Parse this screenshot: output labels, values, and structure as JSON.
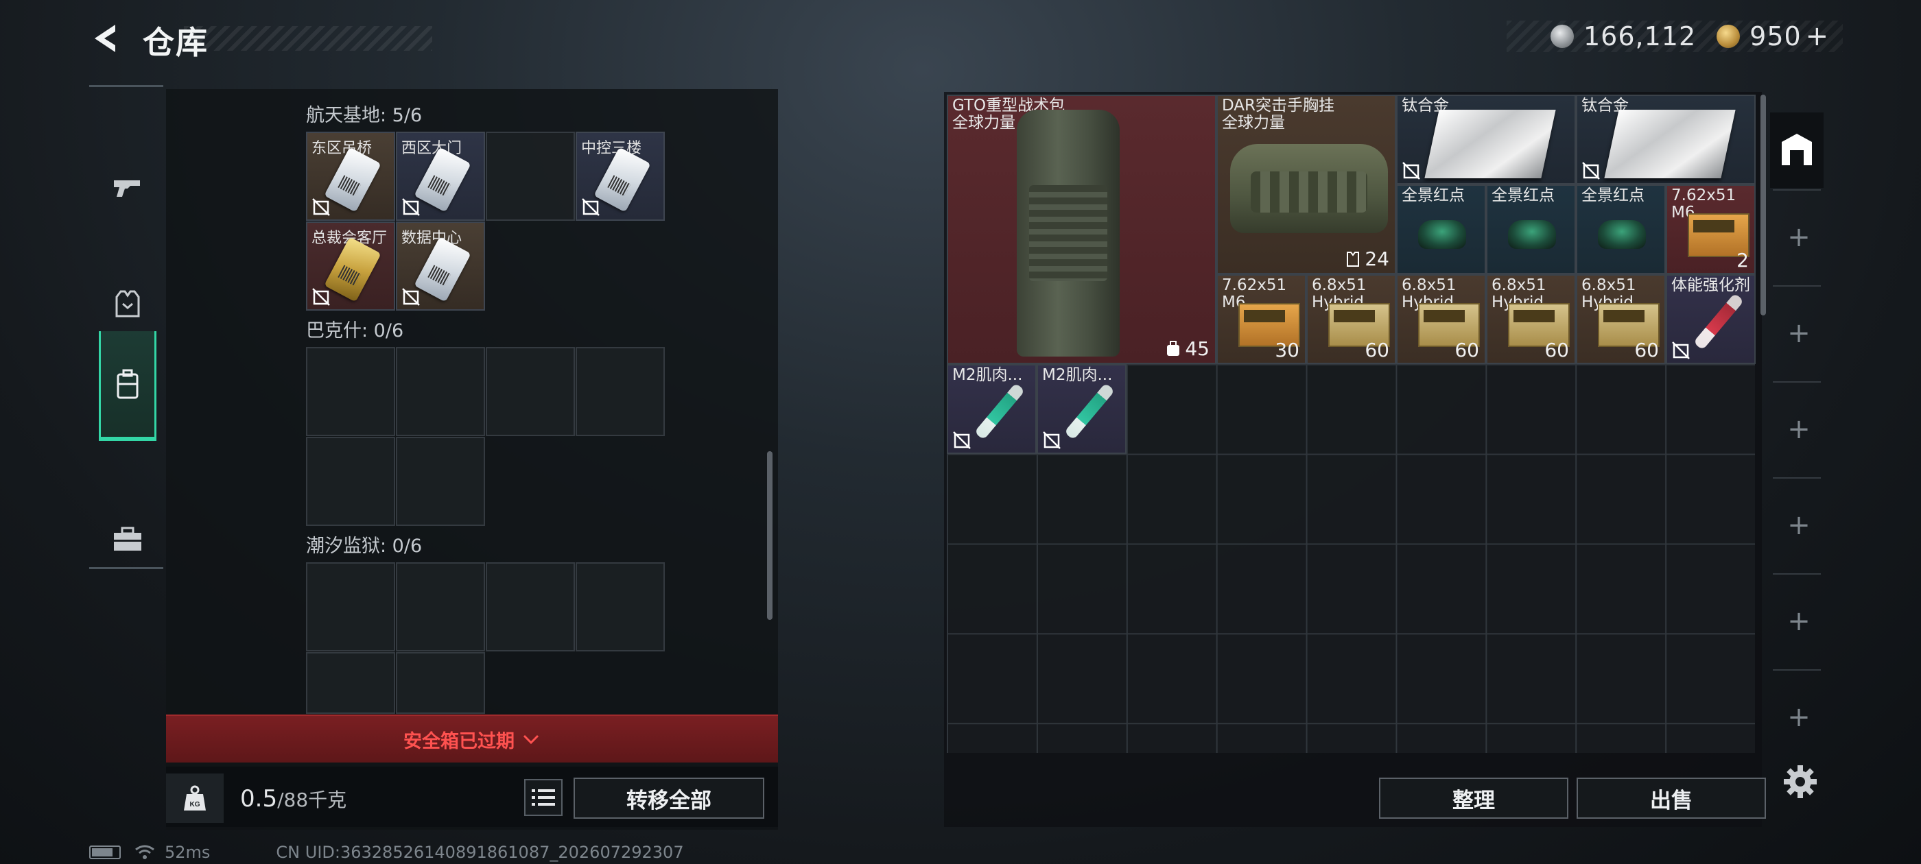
{
  "header": {
    "title": "仓库",
    "currency": {
      "silver": "166,112",
      "gold": "950",
      "gold_plus": "+"
    }
  },
  "nav": {
    "items": [
      "weapon",
      "armor",
      "backpack",
      "toolbox"
    ],
    "active": "backpack"
  },
  "safebox": {
    "sections": [
      {
        "title": "航天基地: 5/6",
        "keys": [
          {
            "label": "东区吊桥",
            "color": "tan"
          },
          {
            "label": "西区大门",
            "color": "blue"
          },
          {
            "label": "",
            "color": "empty"
          },
          {
            "label": "中控三楼",
            "color": "blue"
          },
          {
            "label": "总裁会客厅",
            "color": "red"
          },
          {
            "label": "数据中心",
            "color": "tan"
          }
        ]
      },
      {
        "title": "巴克什: 0/6"
      },
      {
        "title": "潮汐监狱: 0/6"
      }
    ],
    "expired_text": "安全箱已过期",
    "weight_value": "0.5",
    "weight_max": "/88千克",
    "transfer_all_label": "转移全部"
  },
  "stash": {
    "items": [
      {
        "name": "GTO重型战术包",
        "sub": "全球力量",
        "badge": "45"
      },
      {
        "name": "DAR突击手胸挂",
        "sub": "全球力量",
        "badge": "24"
      },
      {
        "name": "钛合金"
      },
      {
        "name": "钛合金"
      },
      {
        "name": "全景红点"
      },
      {
        "name": "全景红点"
      },
      {
        "name": "全景红点"
      },
      {
        "name": "7.62x51",
        "sub": "M6...",
        "count": "2"
      },
      {
        "name": "7.62x51",
        "sub": "M6...",
        "count": "30"
      },
      {
        "name": "6.8x51",
        "sub": "Hybrid",
        "count": "60"
      },
      {
        "name": "6.8x51",
        "sub": "Hybrid",
        "count": "60"
      },
      {
        "name": "6.8x51",
        "sub": "Hybrid",
        "count": "60"
      },
      {
        "name": "6.8x51",
        "sub": "Hybrid",
        "count": "60"
      },
      {
        "name": "体能强化剂"
      },
      {
        "name": "M2肌肉..."
      },
      {
        "name": "M2肌肉..."
      }
    ],
    "sort_label": "整理",
    "sell_label": "出售"
  },
  "status": {
    "ping": "52ms",
    "uid": "CN UID:3632852614089186108​7_202607292307"
  }
}
